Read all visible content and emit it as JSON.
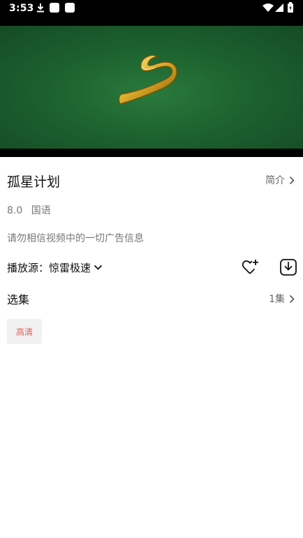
{
  "status_bar": {
    "time": "3:53",
    "icons": [
      "download-icon",
      "app-icon",
      "app-icon",
      "wifi-icon",
      "signal-icon",
      "battery-icon"
    ]
  },
  "video": {
    "poster_icon": "gold-s-logo-icon"
  },
  "details": {
    "title": "孤星计划",
    "intro_label": "简介",
    "rating": "8.0",
    "language": "国语",
    "notice": "请勿相信视频中的一切广告信息"
  },
  "source": {
    "label": "播放源：",
    "value": "惊雷极速"
  },
  "episodes": {
    "title": "选集",
    "count": "1集",
    "items": [
      "高清"
    ]
  },
  "colors": {
    "episode_chip_text": "#e85a5a",
    "video_bg": "#1d6230"
  }
}
